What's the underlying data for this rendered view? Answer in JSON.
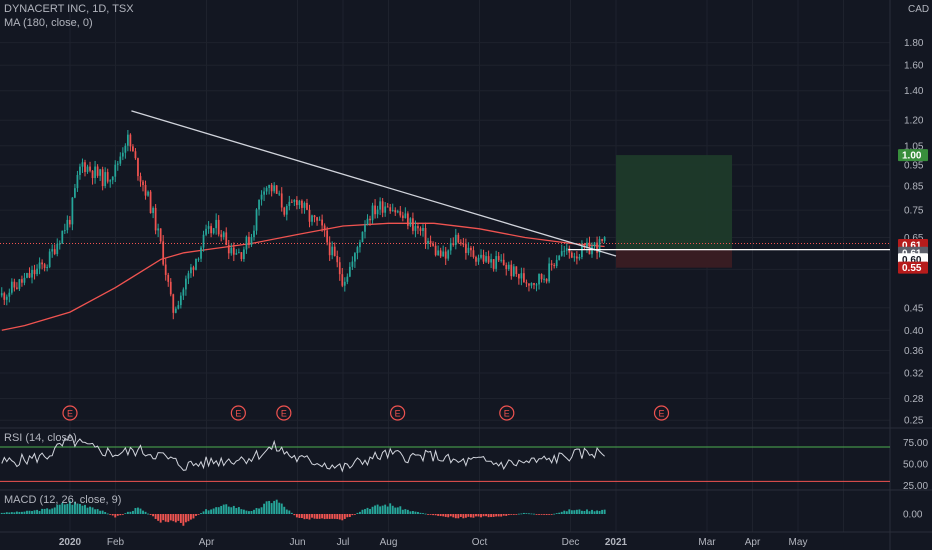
{
  "header": {
    "title": "DYNACERT INC, 1D, TSX",
    "ma_label": "MA (180, close, 0)",
    "rsi_label": "RSI (14, close)",
    "macd_label": "MACD (12, 26, close, 9)",
    "currency": "CAD"
  },
  "earnings_marker": "E",
  "colors": {
    "background": "#131722",
    "up": "#26a69a",
    "down": "#ef5350",
    "ma": "#ef5350",
    "trendline": "#d1d4dc",
    "rsi": "#d1d4dc",
    "rsi_upper_band": "#4caf50",
    "rsi_lower_band": "#ef5350",
    "profit_zone": "#1e3a2a",
    "loss_zone": "#3a1c23",
    "label_green": "#388e3c",
    "label_red": "#b71c1c",
    "label_gray": "#5d606b",
    "label_white": "#ffffff"
  },
  "price_badges": [
    {
      "text": "1.00",
      "value": 1.0,
      "kind": "green"
    },
    {
      "text": "0.61",
      "value": 0.625,
      "kind": "red"
    },
    {
      "text": "0.61",
      "value": 0.6,
      "kind": "gray"
    },
    {
      "text": "0.60",
      "value": 0.58,
      "kind": "white"
    },
    {
      "text": "0.55",
      "value": 0.555,
      "kind": "red"
    }
  ],
  "chart_data": {
    "type": "candlestick",
    "title": "DYNACERT INC, 1D, TSX",
    "y_scale": "log",
    "ylim": [
      0.24,
      2.25
    ],
    "ytick_labels": [
      "0.25",
      "0.28",
      "0.32",
      "0.36",
      "0.40",
      "0.45",
      "0.55",
      "0.65",
      "0.75",
      "0.85",
      "0.95",
      "1.05",
      "1.20",
      "1.40",
      "1.60",
      "1.80"
    ],
    "ytick_values": [
      0.25,
      0.28,
      0.32,
      0.36,
      0.4,
      0.45,
      0.55,
      0.65,
      0.75,
      0.85,
      0.95,
      1.05,
      1.2,
      1.4,
      1.6,
      1.8
    ],
    "xtick_labels": [
      "2020",
      "Feb",
      "Apr",
      "Jun",
      "Jul",
      "Aug",
      "Oct",
      "Dec",
      "2021",
      "Mar",
      "Apr",
      "May"
    ],
    "xtick_bold": [
      true,
      false,
      false,
      false,
      false,
      false,
      false,
      false,
      true,
      false,
      false,
      false
    ],
    "xtick_month_index": [
      0,
      1,
      3,
      5,
      6,
      7,
      9,
      11,
      12,
      14,
      15,
      16
    ],
    "last_month_index": 17,
    "price_series": {
      "month_index": [
        -1.5,
        -1.0,
        -0.5,
        0.0,
        0.25,
        0.5,
        0.75,
        1.0,
        1.25,
        1.5,
        1.75,
        2.0,
        2.25,
        2.5,
        2.75,
        3.0,
        3.25,
        3.5,
        3.75,
        4.0,
        4.25,
        4.5,
        4.75,
        5.0,
        5.25,
        5.5,
        5.75,
        6.0,
        6.25,
        6.5,
        6.75,
        7.0,
        7.25,
        7.5,
        7.75,
        8.0,
        8.25,
        8.5,
        8.75,
        9.0,
        9.25,
        9.5,
        9.75,
        10.0,
        10.25,
        10.5,
        10.75,
        11.0,
        11.25,
        11.5,
        11.75
      ],
      "close": [
        0.48,
        0.52,
        0.57,
        0.72,
        0.96,
        0.92,
        0.88,
        0.93,
        1.1,
        0.92,
        0.78,
        0.62,
        0.44,
        0.5,
        0.58,
        0.66,
        0.69,
        0.62,
        0.6,
        0.66,
        0.86,
        0.83,
        0.74,
        0.8,
        0.72,
        0.69,
        0.6,
        0.52,
        0.58,
        0.72,
        0.76,
        0.78,
        0.73,
        0.7,
        0.66,
        0.61,
        0.58,
        0.66,
        0.6,
        0.59,
        0.57,
        0.57,
        0.54,
        0.52,
        0.52,
        0.54,
        0.6,
        0.6,
        0.6,
        0.62,
        0.63
      ]
    },
    "ma_series": {
      "name": "MA (180, close, 0)",
      "month_index": [
        -1.5,
        -1.0,
        0.0,
        1.0,
        2.0,
        2.5,
        3.0,
        4.0,
        5.0,
        6.0,
        7.0,
        8.0,
        9.0,
        10.0,
        11.0,
        11.75
      ],
      "values": [
        0.4,
        0.41,
        0.44,
        0.5,
        0.58,
        0.6,
        0.61,
        0.63,
        0.66,
        0.69,
        0.7,
        0.7,
        0.68,
        0.65,
        0.63,
        0.62
      ]
    },
    "trendline": {
      "start": {
        "month_index": 1.35,
        "value": 1.26
      },
      "end": {
        "month_index": 12.0,
        "value": 0.59
      }
    },
    "breakout_line": {
      "start": {
        "month_index": 10.95,
        "value": 0.61
      },
      "end": {
        "month_index": 12.65,
        "value": 0.61
      }
    },
    "position": {
      "start_month_index": 12.0,
      "end_month_index": 14.55,
      "entry": 0.61,
      "target": 1.0,
      "stop": 0.555
    },
    "earnings_month_index": [
      0.0,
      3.7,
      4.7,
      7.2,
      9.6,
      13.0
    ],
    "rsi": {
      "name": "RSI (14, close)",
      "ytick_labels": [
        "75.00",
        "50.00",
        "25.00"
      ],
      "ytick_values": [
        75,
        50,
        25
      ],
      "ylim": [
        20,
        92
      ],
      "bands": [
        70,
        30
      ],
      "month_index": [
        -1.5,
        -1.0,
        -0.5,
        0.0,
        0.5,
        1.0,
        1.5,
        2.0,
        2.5,
        3.0,
        3.5,
        4.0,
        4.5,
        5.0,
        5.5,
        6.0,
        6.5,
        7.0,
        7.5,
        8.0,
        8.5,
        9.0,
        9.5,
        10.0,
        10.5,
        11.0,
        11.5,
        11.75
      ],
      "values": [
        52,
        55,
        60,
        78,
        68,
        62,
        66,
        60,
        48,
        52,
        55,
        58,
        70,
        56,
        52,
        45,
        55,
        62,
        58,
        60,
        52,
        54,
        50,
        52,
        55,
        60,
        64,
        62
      ]
    },
    "macd": {
      "name": "MACD (12, 26, close, 9)",
      "ytick_labels": [
        "0.00"
      ],
      "ytick_values": [
        0
      ],
      "ylim": [
        -0.03,
        0.04
      ],
      "month_index": [
        -1.5,
        -1.0,
        -0.5,
        0.0,
        0.5,
        1.0,
        1.5,
        2.0,
        2.5,
        3.0,
        3.5,
        4.0,
        4.5,
        5.0,
        5.5,
        6.0,
        6.5,
        7.0,
        7.5,
        8.0,
        8.5,
        9.0,
        9.5,
        10.0,
        10.5,
        11.0,
        11.5,
        11.75
      ],
      "histogram": [
        0.002,
        0.004,
        0.008,
        0.02,
        0.012,
        -0.005,
        0.01,
        -0.012,
        -0.016,
        0.007,
        0.015,
        0.004,
        0.025,
        -0.006,
        -0.009,
        -0.011,
        0.01,
        0.016,
        0.005,
        -0.002,
        -0.006,
        -0.005,
        -0.004,
        0.002,
        -0.002,
        0.007,
        0.006,
        0.007
      ]
    }
  }
}
